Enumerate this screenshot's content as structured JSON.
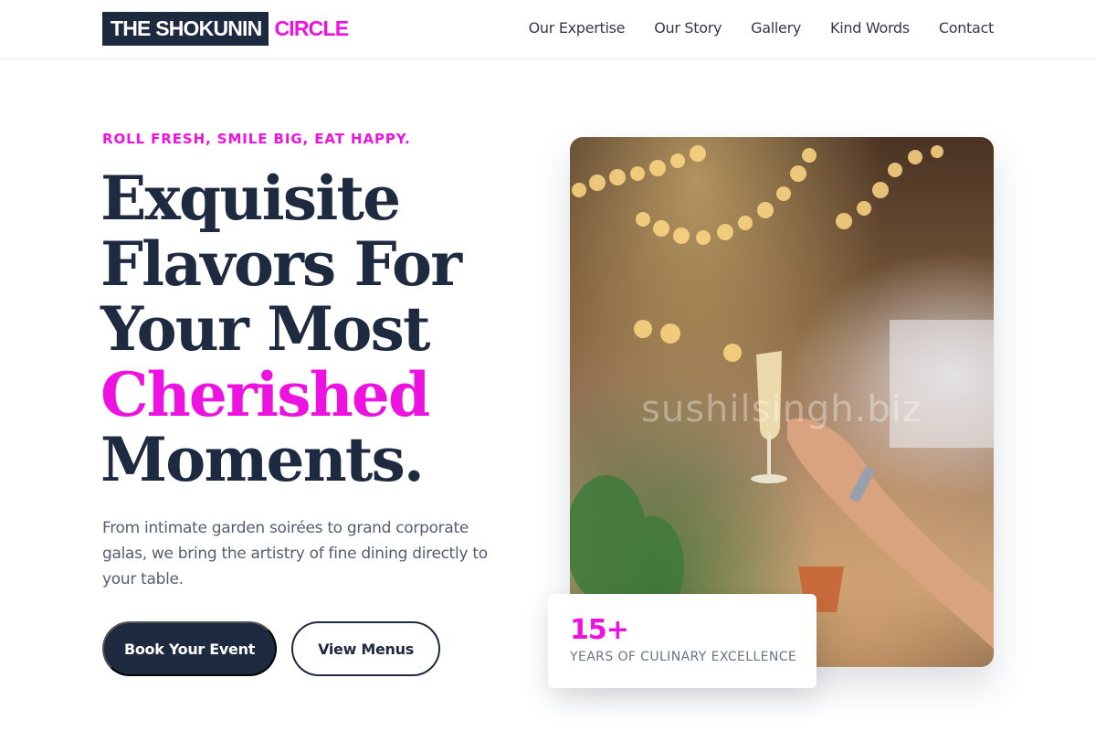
{
  "brand": {
    "name_main": "THE SHOKUNIN",
    "name_accent": "CIRCLE",
    "primary_color": "#1e2a40",
    "accent_color": "#ee12e0"
  },
  "nav": {
    "items": [
      {
        "label": "Our Expertise"
      },
      {
        "label": "Our Story"
      },
      {
        "label": "Gallery"
      },
      {
        "label": "Kind Words"
      },
      {
        "label": "Contact"
      }
    ]
  },
  "hero": {
    "eyebrow": "ROLL FRESH, SMILE BIG, EAT HAPPY.",
    "headline_lines": [
      "Exquisite",
      "Flavors For",
      "Your Most"
    ],
    "headline_accent": "Cherished",
    "headline_end": "Moments.",
    "description": "From intimate garden soirées to grand corporate galas, we bring the artistry of fine dining directly to your table.",
    "primary_button": "Book Your Event",
    "secondary_button": "View Menus",
    "image_watermark": "sushilsingh.biz"
  },
  "stat": {
    "value": "15+",
    "label": "YEARS OF CULINARY EXCELLENCE"
  }
}
